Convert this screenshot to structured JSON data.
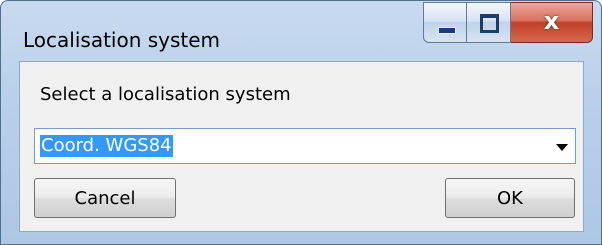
{
  "window": {
    "title": "Localisation system",
    "controls": {
      "minimize_icon": "minimize-icon",
      "maximize_icon": "maximize-icon",
      "close_icon": "close-icon",
      "close_glyph": "x"
    }
  },
  "dialog": {
    "prompt": "Select a localisation system",
    "select": {
      "value": "Coord. WGS84",
      "selected_highlight": "#3399ff"
    },
    "buttons": {
      "cancel": "Cancel",
      "ok": "OK"
    }
  }
}
